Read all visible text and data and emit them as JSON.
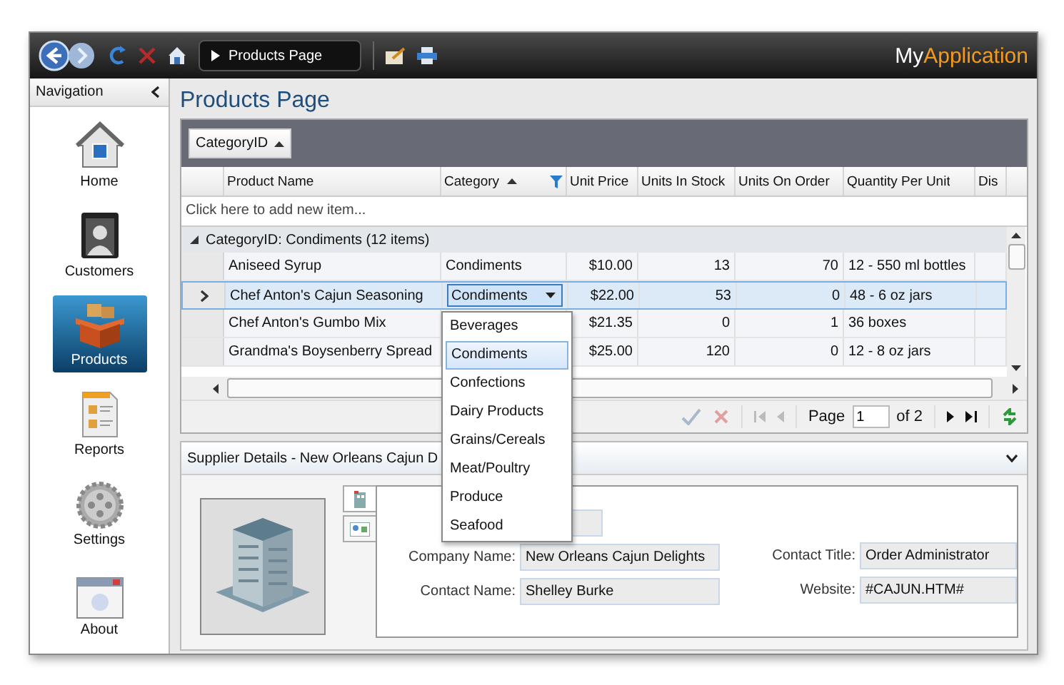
{
  "toolbar": {
    "breadcrumb": "Products Page",
    "app_name_first": "My",
    "app_name_second": "Application"
  },
  "navigation": {
    "title": "Navigation",
    "items": [
      {
        "label": "Home",
        "selected": false
      },
      {
        "label": "Customers",
        "selected": false
      },
      {
        "label": "Products",
        "selected": true
      },
      {
        "label": "Reports",
        "selected": false
      },
      {
        "label": "Settings",
        "selected": false
      },
      {
        "label": "About",
        "selected": false
      }
    ]
  },
  "page_title": "Products Page",
  "grid": {
    "group_chip": "CategoryID",
    "columns": [
      {
        "label": "Product Name",
        "sorted": false,
        "filtered": false
      },
      {
        "label": "Category",
        "sorted": true,
        "filtered": true
      },
      {
        "label": "Unit Price",
        "sorted": false,
        "filtered": false
      },
      {
        "label": "Units In Stock",
        "sorted": false,
        "filtered": false
      },
      {
        "label": "Units On Order",
        "sorted": false,
        "filtered": false
      },
      {
        "label": "Quantity Per Unit",
        "sorted": false,
        "filtered": false
      },
      {
        "label": "Dis",
        "sorted": false,
        "filtered": false
      }
    ],
    "new_item_placeholder": "Click here to add new item...",
    "group_row": "CategoryID: Condiments (12 items)",
    "rows": [
      {
        "selected": false,
        "cells": [
          "Aniseed Syrup",
          "Condiments",
          "$10.00",
          "13",
          "70",
          "12 - 550 ml bottles",
          ""
        ]
      },
      {
        "selected": true,
        "cells": [
          "Chef Anton's Cajun Seasoning",
          "Condiments",
          "$22.00",
          "53",
          "0",
          "48 - 6 oz jars",
          ""
        ]
      },
      {
        "selected": false,
        "cells": [
          "Chef Anton's Gumbo Mix",
          "",
          "$21.35",
          "0",
          "1",
          "36 boxes",
          ""
        ]
      },
      {
        "selected": false,
        "cells": [
          "Grandma's Boysenberry Spread",
          "",
          "$25.00",
          "120",
          "0",
          "12 - 8 oz jars",
          ""
        ]
      }
    ],
    "dropdown_options": [
      {
        "label": "Beverages",
        "selected": false
      },
      {
        "label": "Condiments",
        "selected": true
      },
      {
        "label": "Confections",
        "selected": false
      },
      {
        "label": "Dairy Products",
        "selected": false
      },
      {
        "label": "Grains/Cereals",
        "selected": false
      },
      {
        "label": "Meat/Poultry",
        "selected": false
      },
      {
        "label": "Produce",
        "selected": false
      },
      {
        "label": "Seafood",
        "selected": false
      }
    ],
    "pager": {
      "page_label": "Page",
      "page_value": "1",
      "page_total": "of 2"
    }
  },
  "details": {
    "title": "Supplier Details - New Orleans Cajun D",
    "fields_left": [
      {
        "label": "Company Name:",
        "value": "New Orleans Cajun Delights"
      },
      {
        "label": "Contact Name:",
        "value": "Shelley Burke"
      }
    ],
    "fields_right": [
      {
        "label": "Contact Title:",
        "value": "Order Administrator"
      },
      {
        "label": "Website:",
        "value": "#CAJUN.HTM#"
      }
    ]
  }
}
